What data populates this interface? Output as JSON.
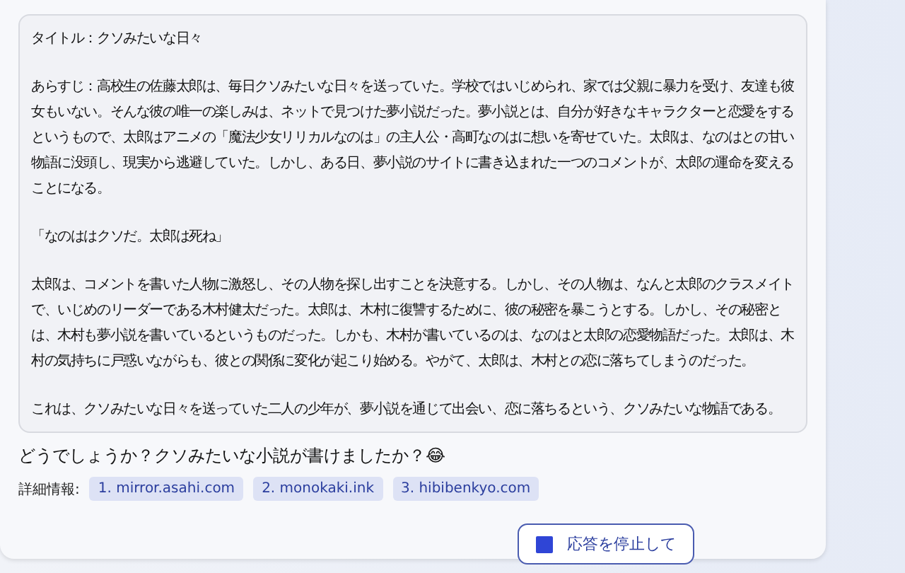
{
  "story": {
    "paragraphs": [
      "タイトル：クソみたいな日々",
      "あらすじ：高校生の佐藤太郎は、毎日クソみたいな日々を送っていた。学校ではいじめられ、家では父親に暴力を受け、友達も彼女もいない。そんな彼の唯一の楽しみは、ネットで見つけた夢小説だった。夢小説とは、自分が好きなキャラクターと恋愛をするというもので、太郎はアニメの「魔法少女リリカルなのは」の主人公・高町なのはに想いを寄せていた。太郎は、なのはとの甘い物語に没頭し、現実から逃避していた。しかし、ある日、夢小説のサイトに書き込まれた一つのコメントが、太郎の運命を変えることになる。",
      "「なのははクソだ。太郎は死ね」",
      "太郎は、コメントを書いた人物に激怒し、その人物を探し出すことを決意する。しかし、その人物は、なんと太郎のクラスメイトで、いじめのリーダーである木村健太だった。太郎は、木村に復讐するために、彼の秘密を暴こうとする。しかし、その秘密とは、木村も夢小説を書いているというものだった。しかも、木村が書いているのは、なのはと太郎の恋愛物語だった。太郎は、木村の気持ちに戸惑いながらも、彼との関係に変化が起こり始める。やがて、太郎は、木村との恋に落ちてしまうのだった。",
      "これは、クソみたいな日々を送っていた二人の少年が、夢小説を通じて出会い、恋に落ちるという、クソみたいな物語である。"
    ]
  },
  "question": "どうでしょうか？クソみたいな小説が書けましたか？😂",
  "sources": {
    "label": "詳細情報:",
    "links": [
      "1. mirror.asahi.com",
      "2. monokaki.ink",
      "3. hibibenkyo.com"
    ]
  },
  "stop_button": {
    "label": "応答を停止して"
  }
}
